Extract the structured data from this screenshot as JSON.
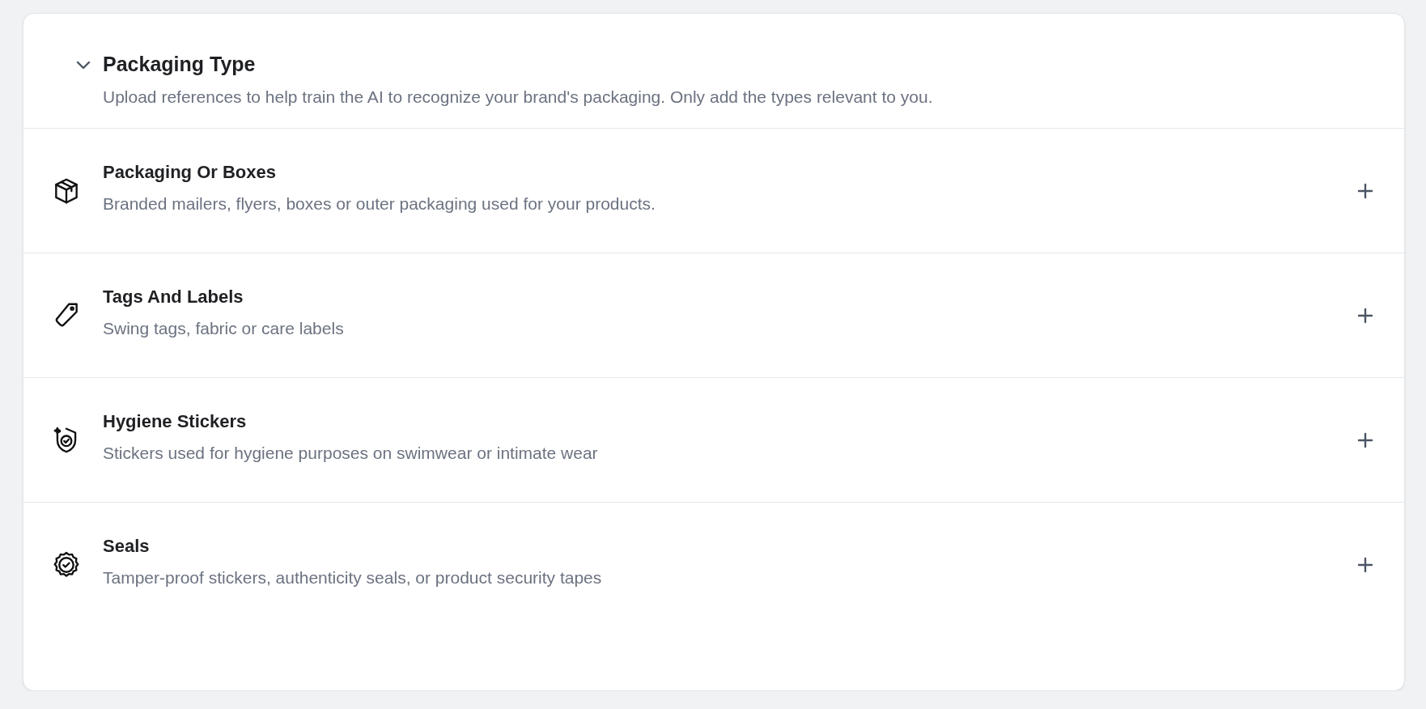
{
  "section": {
    "title": "Packaging Type",
    "description": "Upload references to help train the AI to recognize your brand's packaging. Only add the types relevant to you.",
    "expanded": true
  },
  "items": [
    {
      "kind": "box",
      "title": "Packaging Or Boxes",
      "description": "Branded mailers, flyers, boxes or outer packaging used for your products."
    },
    {
      "kind": "tag",
      "title": "Tags And Labels",
      "description": "Swing tags, fabric or care labels"
    },
    {
      "kind": "shield",
      "title": "Hygiene Stickers",
      "description": "Stickers used for hygiene purposes on swimwear or intimate wear"
    },
    {
      "kind": "seal",
      "title": "Seals",
      "description": "Tamper-proof stickers, authenticity seals, or product security tapes"
    }
  ]
}
